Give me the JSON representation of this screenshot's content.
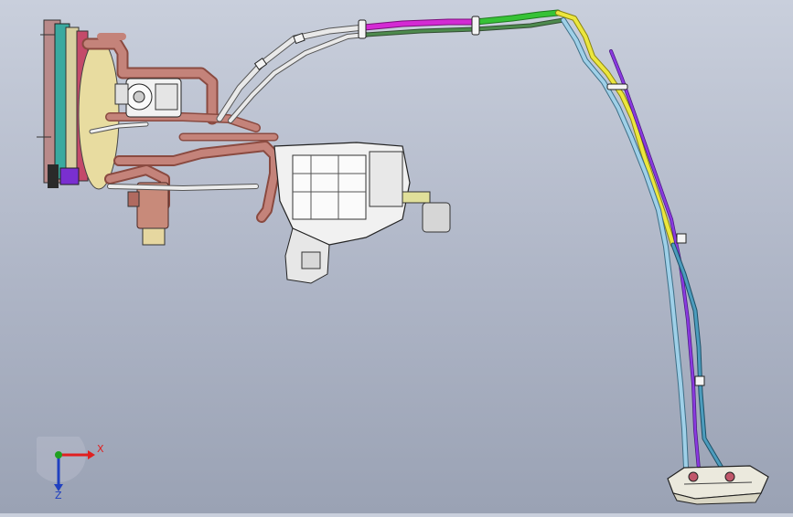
{
  "viewport": {
    "background_top": "#c9cfdc",
    "background_bottom": "#9aa2b4"
  },
  "triad": {
    "x_label": "X",
    "y_label": "Y",
    "z_label": "Z",
    "x_color": "#e02020",
    "y_color": "#20a020",
    "z_color": "#2040c0"
  },
  "pipe_colors": {
    "copper": "#b9776a",
    "white": "#e6e6e6",
    "magenta": "#d020d0",
    "green": "#30c030",
    "yellow": "#e6e23a",
    "purple": "#7a2fd0",
    "lightblue": "#8fc7e0",
    "teal": "#4090b0"
  }
}
